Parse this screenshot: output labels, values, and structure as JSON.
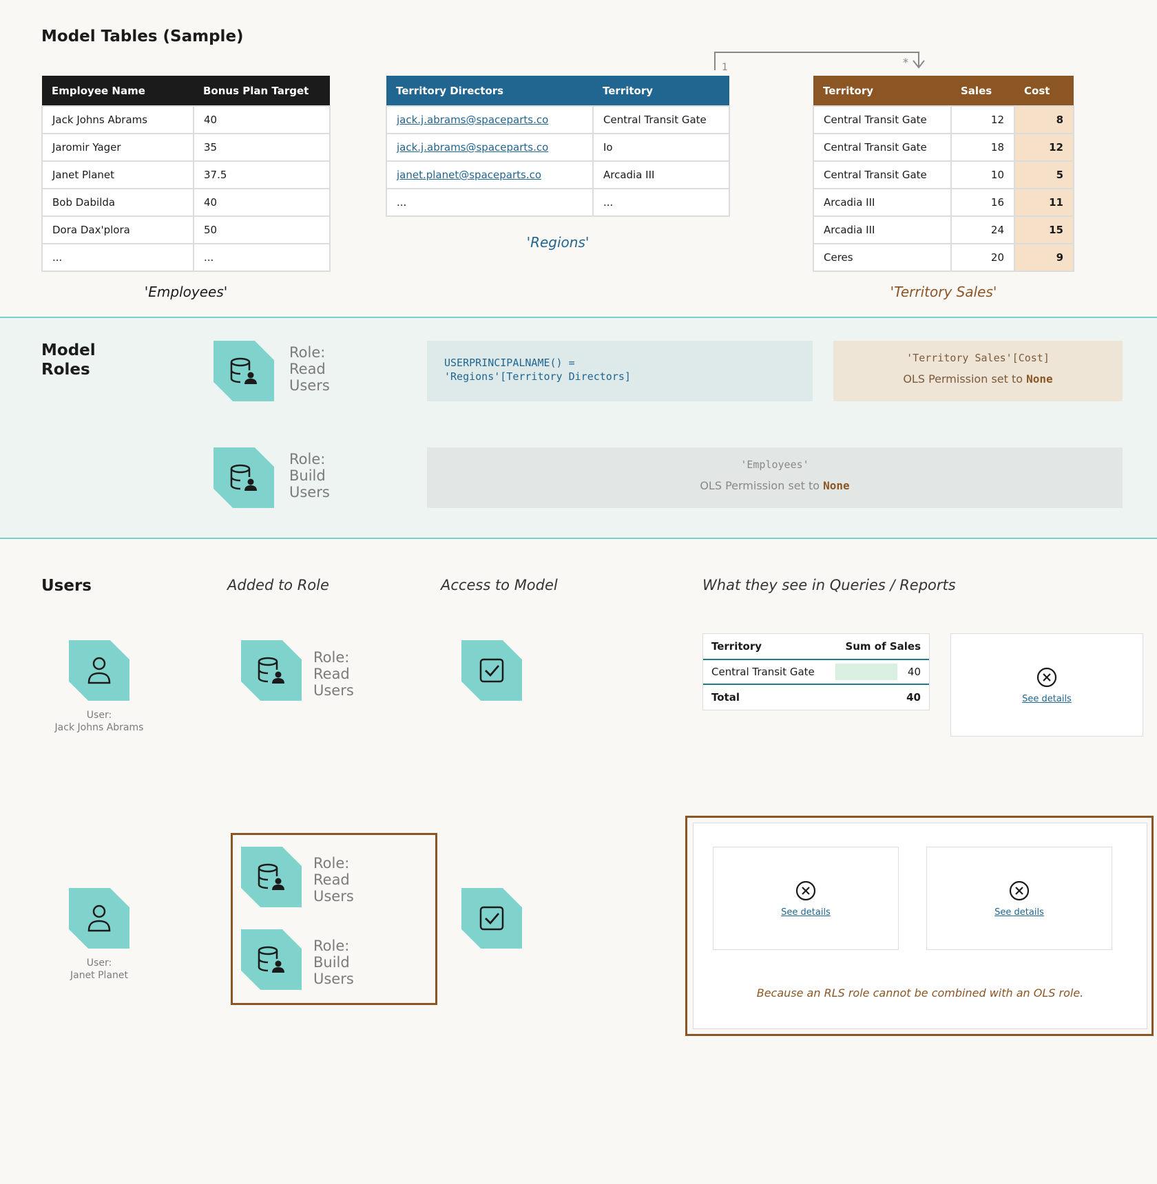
{
  "model_tables_title": "Model Tables (Sample)",
  "employees": {
    "headers": [
      "Employee Name",
      "Bonus Plan Target"
    ],
    "rows": [
      [
        "Jack Johns Abrams",
        "40"
      ],
      [
        "Jaromir Yager",
        "35"
      ],
      [
        "Janet Planet",
        "37.5"
      ],
      [
        "Bob Dabilda",
        "40"
      ],
      [
        "Dora Dax'plora",
        "50"
      ],
      [
        "...",
        "..."
      ]
    ],
    "caption": "'Employees'"
  },
  "regions": {
    "headers": [
      "Territory Directors",
      "Territory"
    ],
    "rows": [
      [
        "jack.j.abrams@spaceparts.co",
        "Central Transit Gate"
      ],
      [
        "jack.j.abrams@spaceparts.co",
        "Io"
      ],
      [
        "janet.planet@spaceparts.co",
        "Arcadia III"
      ],
      [
        "...",
        "..."
      ]
    ],
    "caption": "'Regions'"
  },
  "relationship": {
    "one": "1",
    "many": "*"
  },
  "territory_sales": {
    "headers": [
      "Territory",
      "Sales",
      "Cost"
    ],
    "rows": [
      [
        "Central Transit Gate",
        "12",
        "8"
      ],
      [
        "Central Transit Gate",
        "18",
        "12"
      ],
      [
        "Central Transit Gate",
        "10",
        "5"
      ],
      [
        "Arcadia III",
        "16",
        "11"
      ],
      [
        "Arcadia III",
        "24",
        "15"
      ],
      [
        "Ceres",
        "20",
        "9"
      ]
    ],
    "caption": "'Territory Sales'"
  },
  "model_roles": {
    "title": "Model Roles",
    "read_role": {
      "label": "Role:\nRead\nUsers"
    },
    "build_role": {
      "label": "Role:\nBuild\nUsers"
    },
    "rls_expression": [
      "USERPRINCIPALNAME() =",
      "'Regions'[Territory Directors]"
    ],
    "ols_cost": {
      "object": "'Territory Sales'[Cost]",
      "text": "OLS Permission set to",
      "value": "None"
    },
    "ols_employees": {
      "object": "'Employees'",
      "text": "OLS Permission set to",
      "value": "None"
    }
  },
  "users_section": {
    "title": "Users",
    "col_added": "Added to Role",
    "col_access": "Access to Model",
    "col_see": "What they see in Queries / Reports"
  },
  "user1": {
    "caption_line1": "User:",
    "caption_line2": "Jack Johns Abrams",
    "role_label": "Role:\nRead\nUsers",
    "result_table": {
      "headers": [
        "Territory",
        "Sum of Sales"
      ],
      "row": [
        "Central Transit Gate",
        "40"
      ],
      "total": [
        "Total",
        "40"
      ],
      "bar_fraction": 1.0
    },
    "error_link": "See details"
  },
  "user2": {
    "caption_line1": "User:",
    "caption_line2": "Janet Planet",
    "role1_label": "Role:\nRead\nUsers",
    "role2_label": "Role:\nBuild\nUsers",
    "error_link_1": "See details",
    "error_link_2": "See details",
    "note": "Because an RLS role cannot be combined with an OLS role."
  },
  "colors": {
    "teal": "#7fd3cc",
    "blue": "#216591",
    "brown": "#8b5624",
    "dark": "#1b1b1b"
  }
}
